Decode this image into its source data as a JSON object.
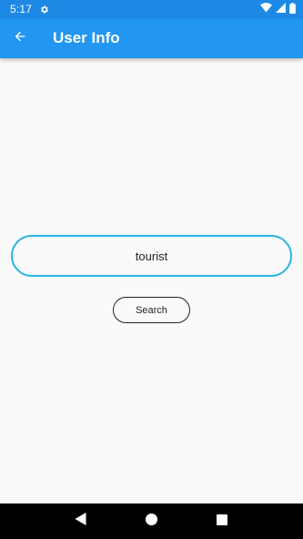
{
  "status_bar": {
    "time": "5:17"
  },
  "app_bar": {
    "title": "User Info"
  },
  "search": {
    "value": "tourist",
    "button_label": "Search"
  },
  "colors": {
    "status_bar": "#1e88e5",
    "app_bar": "#2196f3",
    "input_border": "#29b6e8",
    "background": "#fafafa"
  },
  "icons": {
    "status": [
      "settings-gear-icon",
      "wifi-icon",
      "cell-signal-icon",
      "battery-icon"
    ],
    "app_bar": [
      "back-arrow-icon"
    ],
    "nav": [
      "nav-back-icon",
      "nav-home-icon",
      "nav-recents-icon"
    ]
  }
}
